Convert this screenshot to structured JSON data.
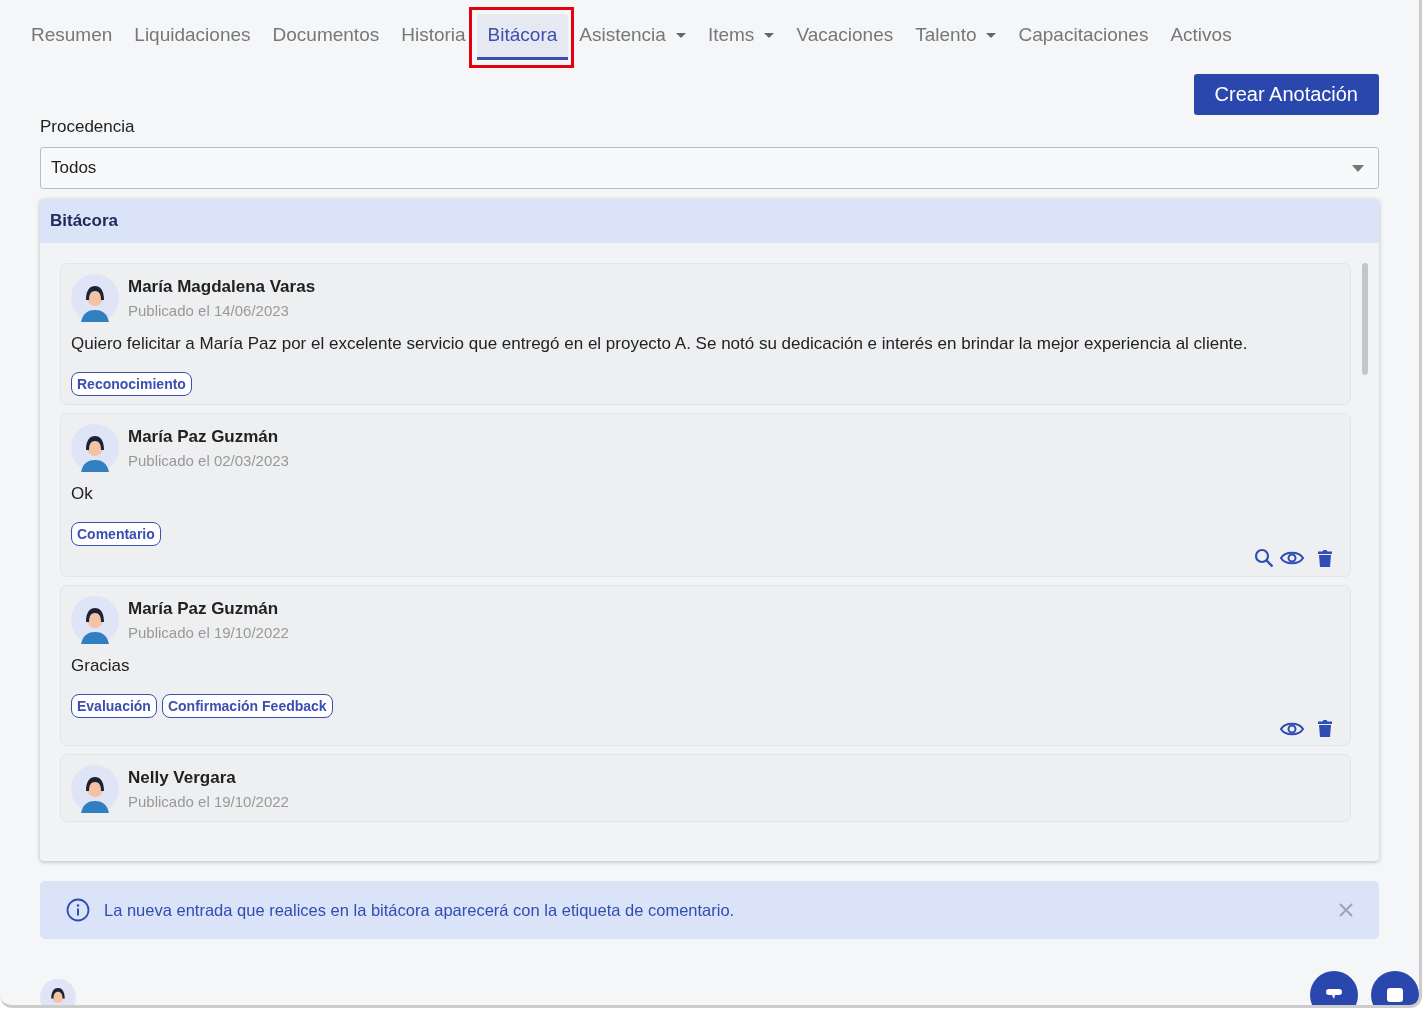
{
  "tabs": [
    {
      "label": "Resumen",
      "selected": false,
      "dropdown": false,
      "highlighted": false
    },
    {
      "label": "Liquidaciones",
      "selected": false,
      "dropdown": false,
      "highlighted": false
    },
    {
      "label": "Documentos",
      "selected": false,
      "dropdown": false,
      "highlighted": false
    },
    {
      "label": "Historia",
      "selected": false,
      "dropdown": false,
      "highlighted": false
    },
    {
      "label": "Bitácora",
      "selected": true,
      "dropdown": false,
      "highlighted": true
    },
    {
      "label": "Asistencia",
      "selected": false,
      "dropdown": true,
      "highlighted": false
    },
    {
      "label": "Items",
      "selected": false,
      "dropdown": true,
      "highlighted": false
    },
    {
      "label": "Vacaciones",
      "selected": false,
      "dropdown": false,
      "highlighted": false
    },
    {
      "label": "Talento",
      "selected": false,
      "dropdown": true,
      "highlighted": false
    },
    {
      "label": "Capacitaciones",
      "selected": false,
      "dropdown": false,
      "highlighted": false
    },
    {
      "label": "Activos",
      "selected": false,
      "dropdown": false,
      "highlighted": false
    }
  ],
  "create_button": "Crear Anotación",
  "filter": {
    "label": "Procedencia",
    "value": "Todos"
  },
  "panel": {
    "title": "Bitácora",
    "entries": [
      {
        "author": "María Magdalena Varas",
        "date": "Publicado el 14/06/2023",
        "text": "Quiero felicitar a María Paz por el excelente servicio que entregó en el proyecto A. Se notó su dedicación e interés en brindar la mejor experiencia al cliente.",
        "tags": [
          "Reconocimiento"
        ]
      },
      {
        "author": "María Paz Guzmán",
        "date": "Publicado el 02/03/2023",
        "text": "Ok",
        "tags": [
          "Comentario"
        ],
        "actions": [
          {
            "kind": "search"
          },
          {
            "kind": "view"
          },
          {
            "kind": "delete"
          }
        ]
      },
      {
        "author": "María Paz Guzmán",
        "date": "Publicado el 19/10/2022",
        "text": "Gracias",
        "tags": [
          "Evaluación",
          "Confirmación Feedback"
        ],
        "actions": [
          {
            "kind": "view"
          },
          {
            "kind": "delete"
          }
        ]
      },
      {
        "author": "Nelly Vergara",
        "date": "Publicado el 19/10/2022"
      }
    ]
  },
  "alert": {
    "text": "La nueva entrada que realices en la bitácora aparecerá con la etiqueta de comentario."
  }
}
